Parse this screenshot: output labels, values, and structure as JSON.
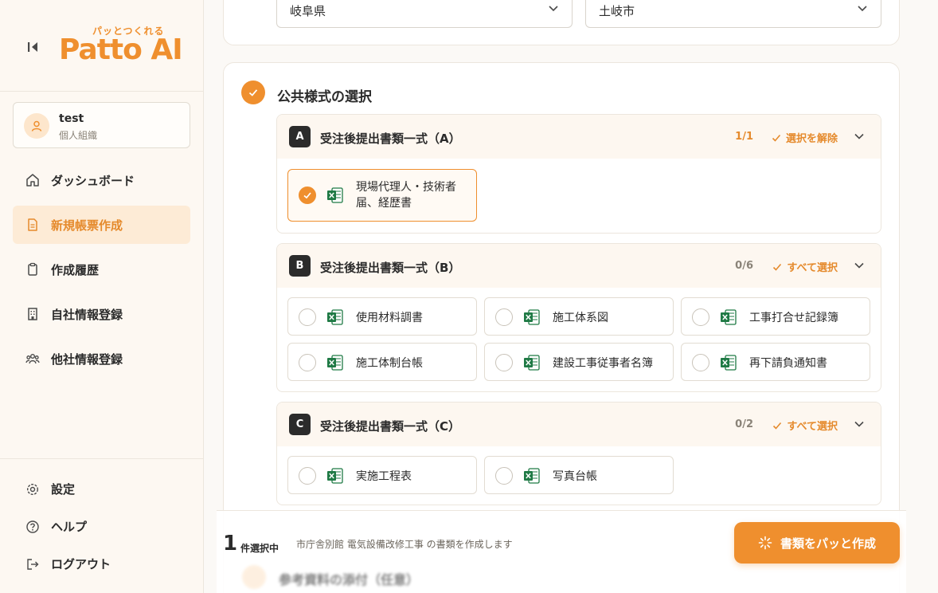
{
  "brand": {
    "tagline": "パッとつくれる",
    "name": "Patto AI"
  },
  "user": {
    "name": "test",
    "org": "個人組織"
  },
  "nav": [
    {
      "label": "ダッシュボード",
      "icon": "home-icon"
    },
    {
      "label": "新規帳票作成",
      "icon": "document-icon",
      "active": true
    },
    {
      "label": "作成履歴",
      "icon": "clipboard-icon"
    },
    {
      "label": "自社情報登録",
      "icon": "building-icon"
    },
    {
      "label": "他社情報登録",
      "icon": "users-icon"
    }
  ],
  "nav_bottom": [
    {
      "label": "設定",
      "icon": "gear-icon"
    },
    {
      "label": "ヘルプ",
      "icon": "help-icon"
    },
    {
      "label": "ログアウト",
      "icon": "logout-icon"
    }
  ],
  "location": {
    "prefecture": "岐阜県",
    "city": "土岐市"
  },
  "section": {
    "title": "公共様式の選択"
  },
  "groups": [
    {
      "letter": "A",
      "title": "受注後提出書類一式（A）",
      "count": "1/1",
      "action": "選択を解除",
      "items": [
        {
          "label": "現場代理人・技術者届、経歴書",
          "checked": true
        }
      ]
    },
    {
      "letter": "B",
      "title": "受注後提出書類一式（B）",
      "count": "0/6",
      "action": "すべて選択",
      "items": [
        {
          "label": "使用材料調書"
        },
        {
          "label": "施工体系図"
        },
        {
          "label": "工事打合せ記録簿"
        },
        {
          "label": "施工体制台帳"
        },
        {
          "label": "建設工事従事者名簿"
        },
        {
          "label": "再下請負通知書"
        }
      ]
    },
    {
      "letter": "C",
      "title": "受注後提出書類一式（C）",
      "count": "0/2",
      "action": "すべて選択",
      "items": [
        {
          "label": "実施工程表"
        },
        {
          "label": "写真台帳"
        }
      ]
    }
  ],
  "footer": {
    "count": "1",
    "count_unit": "件選択中",
    "description": "市庁舎別館 電気設備改修工事 の書類を作成します",
    "create_button": "書類をパッと作成",
    "next_section_peek": "参考資料の添付（任意）"
  },
  "colors": {
    "accent": "#ef8f2e",
    "excel_green": "#1f7a45",
    "dark": "#2b2b2b"
  }
}
